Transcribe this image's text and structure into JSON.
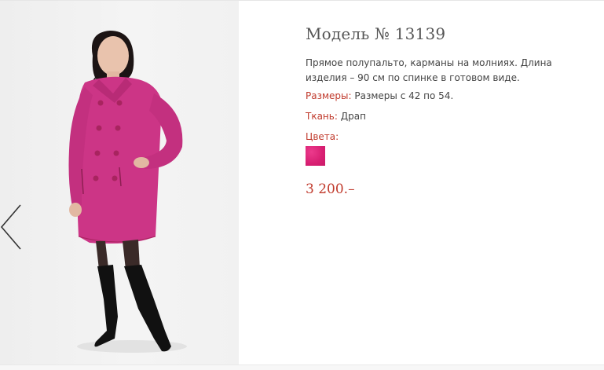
{
  "product": {
    "title": "Модель № 13139",
    "description": "Прямое полупальто, карманы на молниях. Длина изделия – 90 см по спинке в готовом виде.",
    "sizes_label": "Размеры:",
    "sizes_value": "Размеры с 42 по 54.",
    "fabric_label": "Ткань:",
    "fabric_value": "Драп",
    "colors_label": "Цвета:",
    "price": "3 200.–"
  },
  "colors": {
    "accent": "#c0392b",
    "swatch": "#e0247a",
    "coat": "#cc3586"
  },
  "icons": {
    "prev": "chevron-left-icon"
  }
}
